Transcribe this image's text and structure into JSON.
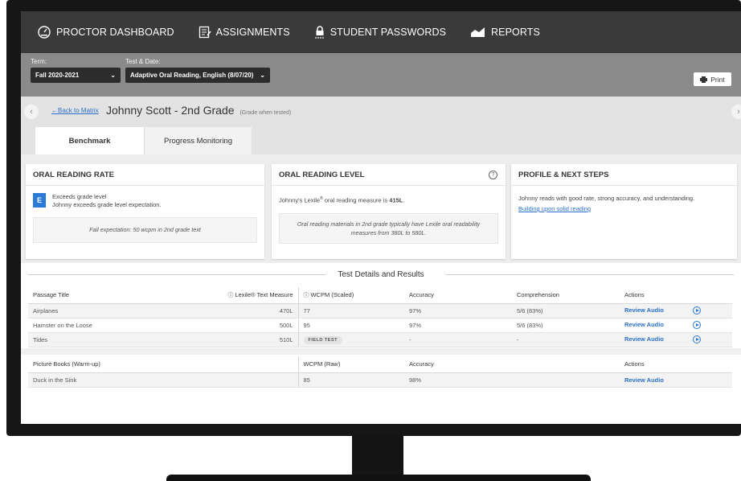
{
  "nav": {
    "items": [
      {
        "label": "PROCTOR DASHBOARD",
        "icon": "dashboard-gauge-icon"
      },
      {
        "label": "ASSIGNMENTS",
        "icon": "document-edit-icon"
      },
      {
        "label": "STUDENT PASSWORDS",
        "icon": "lock-icon"
      },
      {
        "label": "REPORTS",
        "icon": "chart-icon"
      }
    ]
  },
  "filters": {
    "term_label": "Term:",
    "term_value": "Fall 2020-2021",
    "test_label": "Test & Date:",
    "test_value": "Adaptive Oral Reading, English (8/07/20)",
    "print_label": "Print"
  },
  "header": {
    "back_label": "Back to Matrix",
    "student_name": "Johnny Scott - 2nd Grade",
    "student_note": "(Grade when tested)"
  },
  "tabs": [
    {
      "label": "Benchmark",
      "active": true
    },
    {
      "label": "Progress Monitoring",
      "active": false
    }
  ],
  "cards": {
    "rate": {
      "title": "ORAL READING RATE",
      "badge": "E",
      "headline": "Exceeds grade level",
      "detail": "Johnny exceeds grade level expectation.",
      "note": "Fall expectation: 50 wcpm in 2nd grade text"
    },
    "level": {
      "title": "ORAL READING LEVEL",
      "help": "?",
      "text_pre": "Johnny's Lexile",
      "reg": "®",
      "text_mid": " oral reading measure is ",
      "measure": "415L",
      "text_post": ".",
      "note": "Oral reading materials in 2nd grade typically have Lexile oral readability measures from 380L to 580L."
    },
    "profile": {
      "title": "PROFILE & NEXT STEPS",
      "text": "Johnny reads with good rate, strong accuracy, and understanding.",
      "link": "Building upon solid reading"
    }
  },
  "section_title": "Test Details and Results",
  "results_table": {
    "headers": {
      "passage": "Passage Title",
      "lexile": "Lexile® Text Measure",
      "wcpm": "WCPM (Scaled)",
      "accuracy": "Accuracy",
      "comprehension": "Comprehension",
      "actions": "Actions"
    },
    "rows": [
      {
        "title": "Airplanes",
        "lexile": "470L",
        "wcpm": "77",
        "accuracy": "97%",
        "comprehension": "5/6 (83%)",
        "action": "Review Audio"
      },
      {
        "title": "Hamster on the Loose",
        "lexile": "500L",
        "wcpm": "95",
        "accuracy": "97%",
        "comprehension": "5/6 (83%)",
        "action": "Review Audio"
      },
      {
        "title": "Tides",
        "lexile": "510L",
        "wcpm": "FIELD TEST",
        "accuracy": "-",
        "comprehension": "-",
        "action": "Review Audio"
      }
    ]
  },
  "warmup_table": {
    "headers": {
      "passage": "Picture Books (Warm-up)",
      "wcpm": "WCPM (Raw)",
      "accuracy": "Accuracy",
      "actions": "Actions"
    },
    "rows": [
      {
        "title": "Duck in the Sink",
        "wcpm": "85",
        "accuracy": "98%",
        "action": "Review Audio"
      }
    ]
  }
}
